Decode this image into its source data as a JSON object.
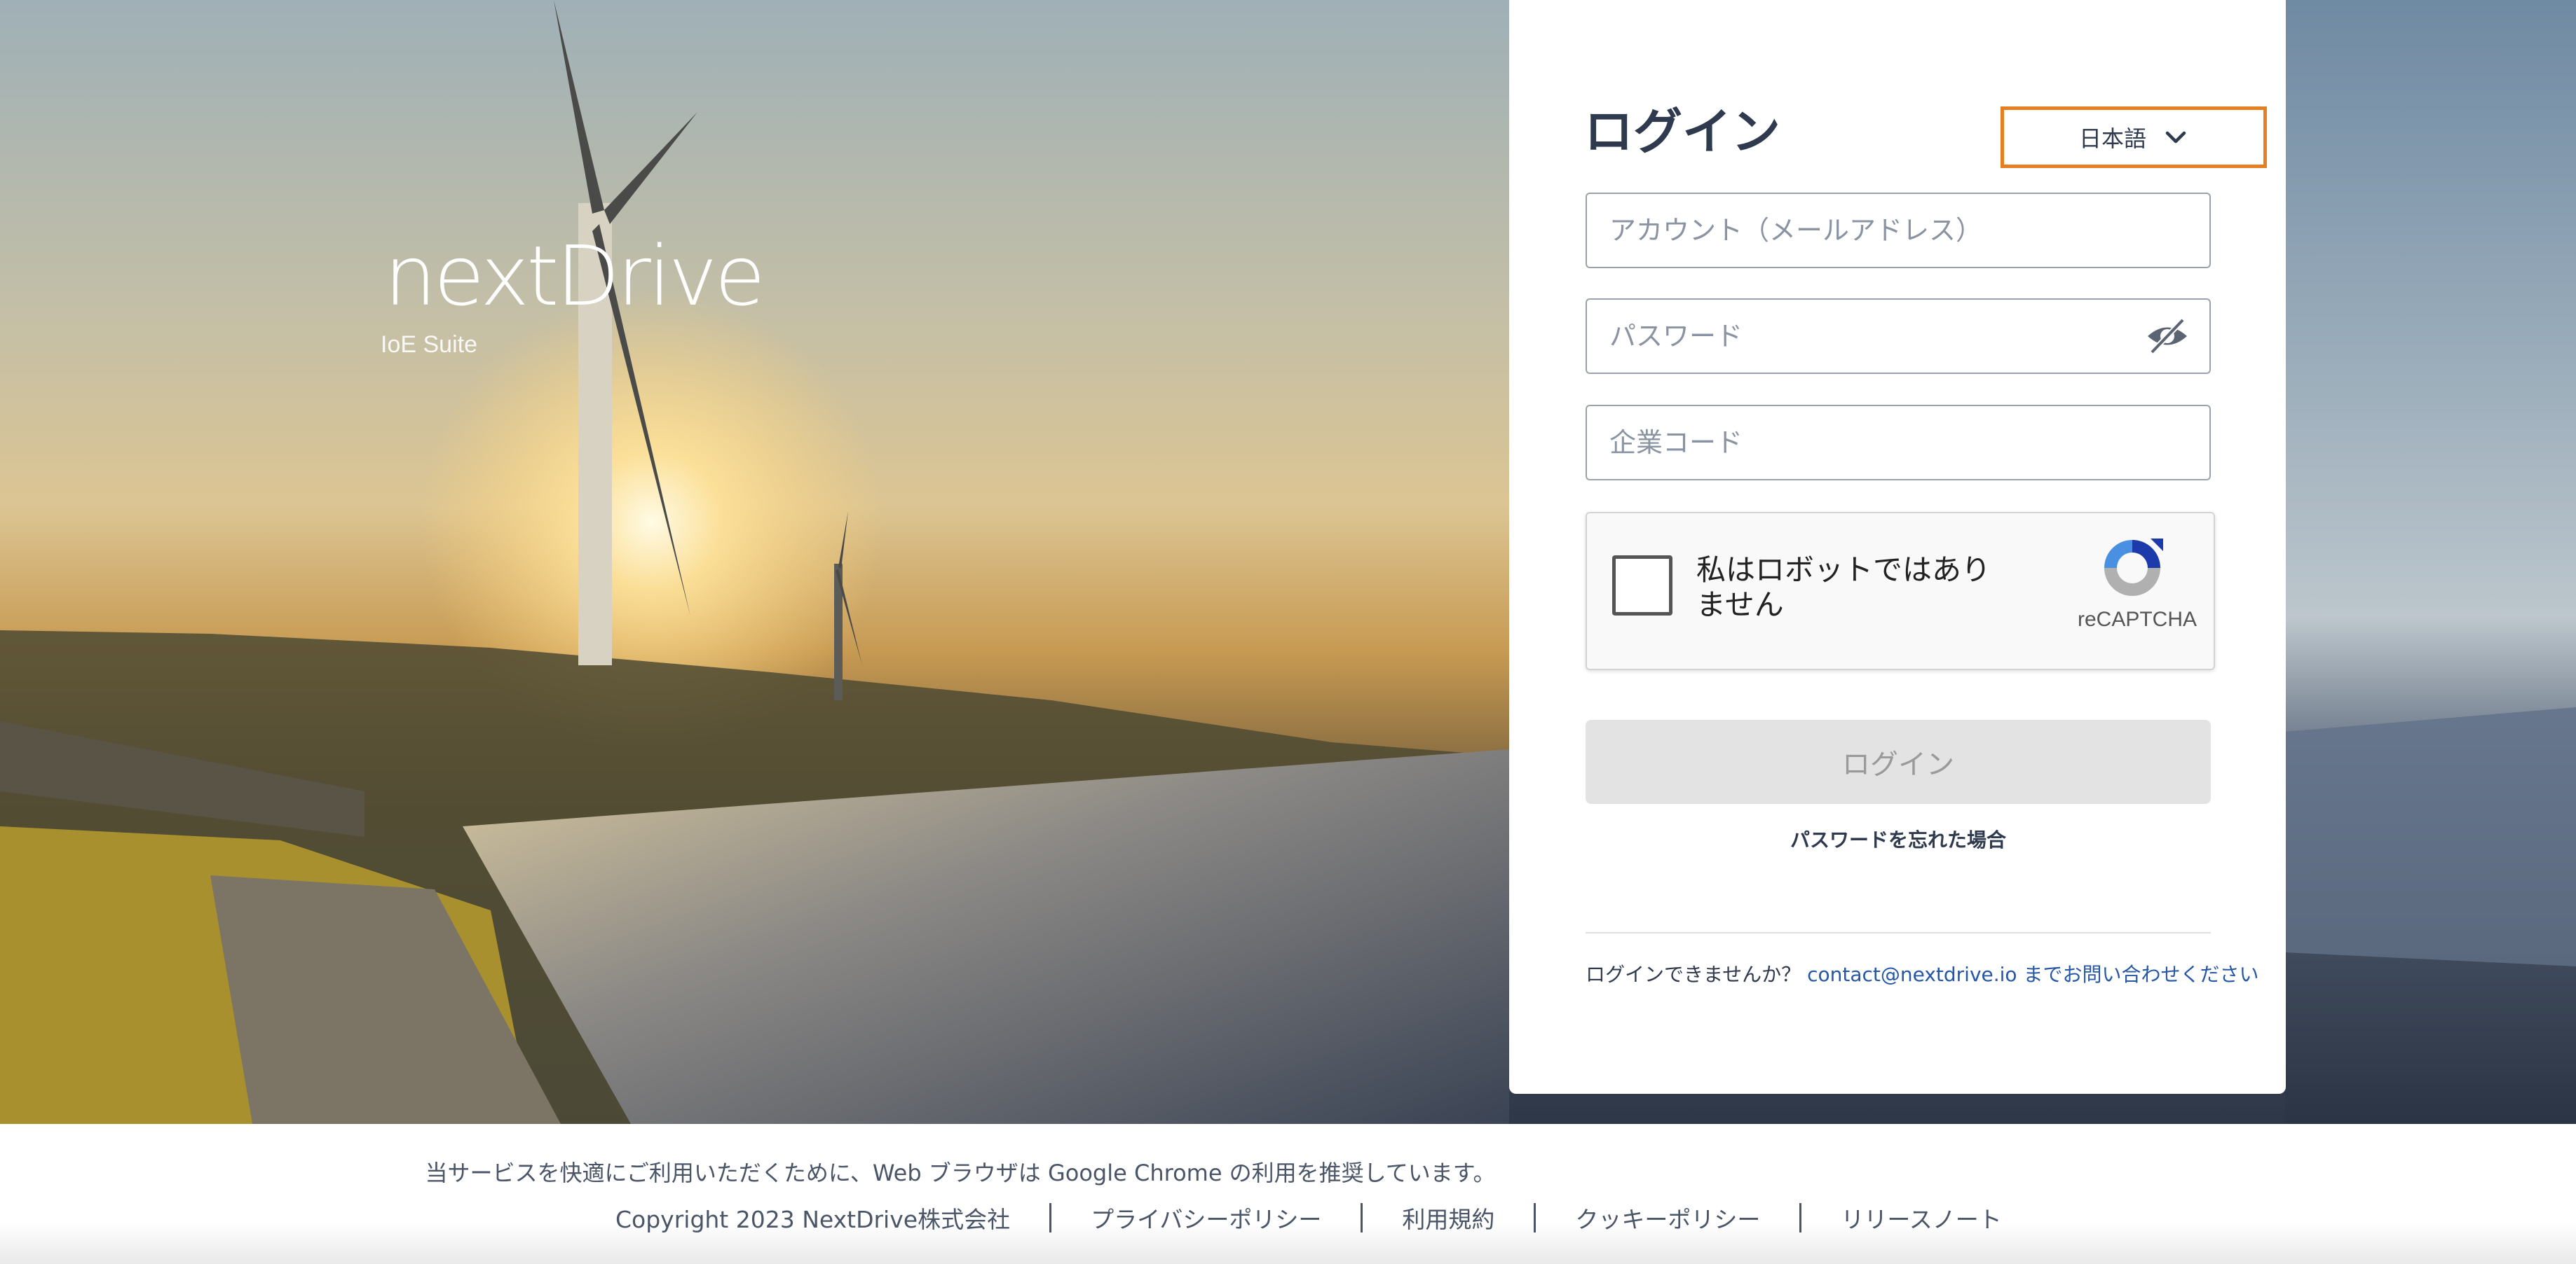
{
  "brand": {
    "logo_text": "nextDrive",
    "sub_text": "IoE Suite"
  },
  "login": {
    "title": "ログイン",
    "language": {
      "selected": "日本語",
      "icon": "chevron-down-icon"
    },
    "account_placeholder": "アカウント（メールアドレス）",
    "password_placeholder": "パスワード",
    "company_code_placeholder": "企業コード",
    "password_toggle_icon": "eye-off-icon",
    "captcha": {
      "label": "私はロボットではありません",
      "brand": "reCAPTCHA"
    },
    "submit_label": "ログイン",
    "forgot_password": "パスワードを忘れた場合",
    "help_prefix": "ログインできませんか？ ",
    "help_link": "contact@nextdrive.io までお問い合わせください"
  },
  "footer": {
    "browser_note": "当サービスを快適にご利用いただくために、Web ブラウザは Google Chrome の利用を推奨しています。",
    "copyright": "Copyright 2023 NextDrive株式会社",
    "links": [
      "プライバシーポリシー",
      "利用規約",
      "クッキーポリシー",
      "リリースノート"
    ]
  },
  "colors": {
    "accent_outline": "#e67e22",
    "text_primary": "#2f3a4e",
    "link": "#2457a6",
    "button_disabled": "#e3e3e3"
  }
}
